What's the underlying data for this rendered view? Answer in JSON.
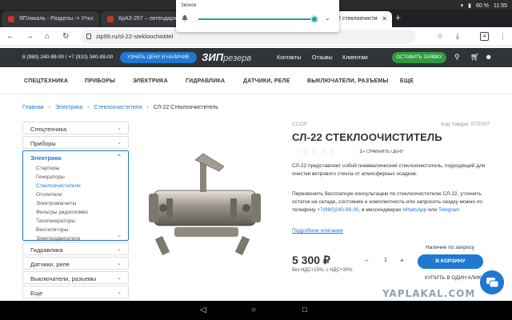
{
  "status": {
    "battery": "60 %",
    "time": "11:55"
  },
  "tabs": [
    {
      "title": "ЯПлакаль - Разделы -> Утк"
    },
    {
      "title": "КрАЗ-257 – легендарн"
    },
    {
      "title": "2 стеклоочисти"
    }
  ],
  "volume": {
    "label": "Звонок",
    "level": 0.93
  },
  "address": {
    "url": "zip99.ru/sl-22-stekloochistitel",
    "tab_count": "4"
  },
  "site": {
    "phones": "8 (980) 240-99-00 / +7 (910) 340-99-00",
    "price_button": "УЗНАТЬ ЦЕНУ И НАЛИЧИЕ",
    "logo_main": "ЗИП",
    "logo_sub": "резерв",
    "top_nav": [
      "Контакты",
      "Отзывы",
      "Клиентам"
    ],
    "order_button": "ОСТАВИТЬ ЗАЯВКУ"
  },
  "categories": [
    "СПЕЦТЕХНИКА",
    "ПРИБОРЫ",
    "ЭЛЕКТРИКА",
    "ГИДРАВЛИКА",
    "ДАТЧИКИ, РЕЛЕ",
    "ВЫКЛЮЧАТЕЛИ, РАЗЪЕМЫ",
    "ЕЩЕ"
  ],
  "breadcrumbs": [
    "Главная",
    "Электрика",
    "Стеклоочистители",
    "СЛ-22 Стеклоочиститель"
  ],
  "sidebar": {
    "top": [
      "Спецтехника",
      "Приборы"
    ],
    "open": {
      "label": "Электрика",
      "subs": [
        "Стартеры",
        "Генераторы",
        "Стеклоочистители",
        "Отопители",
        "Электромагниты",
        "Фильтры радиопомех",
        "Тахогенераторы",
        "Вентиляторы",
        "Электродвигатели"
      ]
    },
    "bottom": [
      "Гидравлика",
      "Датчики, реле",
      "Выключатели, разъемы",
      "Еще"
    ]
  },
  "product": {
    "brand": "СССР",
    "sku": "Код товара: STE007",
    "title": "СЛ-22 СТЕКЛООЧИСТИТЕЛЬ",
    "rating": 0,
    "compare_icon": "Σ+",
    "compare": "СРАВНИТЬ ЦЕНУ",
    "description": "СЛ-22 представляет собой пневматический стеклоочиститель, подходящий для очистки ветрового стекла от атмосферных осадков.",
    "consult_1": "Перезвонить бесплатную консультацию по стеклоочистителю СЛ-22, уточнить остаток на складе, состояние и комплектность или запросить скидку можно по телефону",
    "phone": "+7(980)240-99-00",
    "consult_2": ", в мессенджерах",
    "whatsapp": "WhatsApp",
    "or": "или",
    "telegram": "Telegram",
    "more_link": "Подробное описание",
    "price": "5 300 ₽",
    "vat": "без НДС+15%, с НДС+30%",
    "availability": "Наличие по запросу",
    "quantity": "1",
    "cart_button": "В КОРЗИНУ",
    "one_click": "КУПИТЬ В ОДИН КЛИК"
  },
  "watermark": "YAPLAKAL.COM"
}
